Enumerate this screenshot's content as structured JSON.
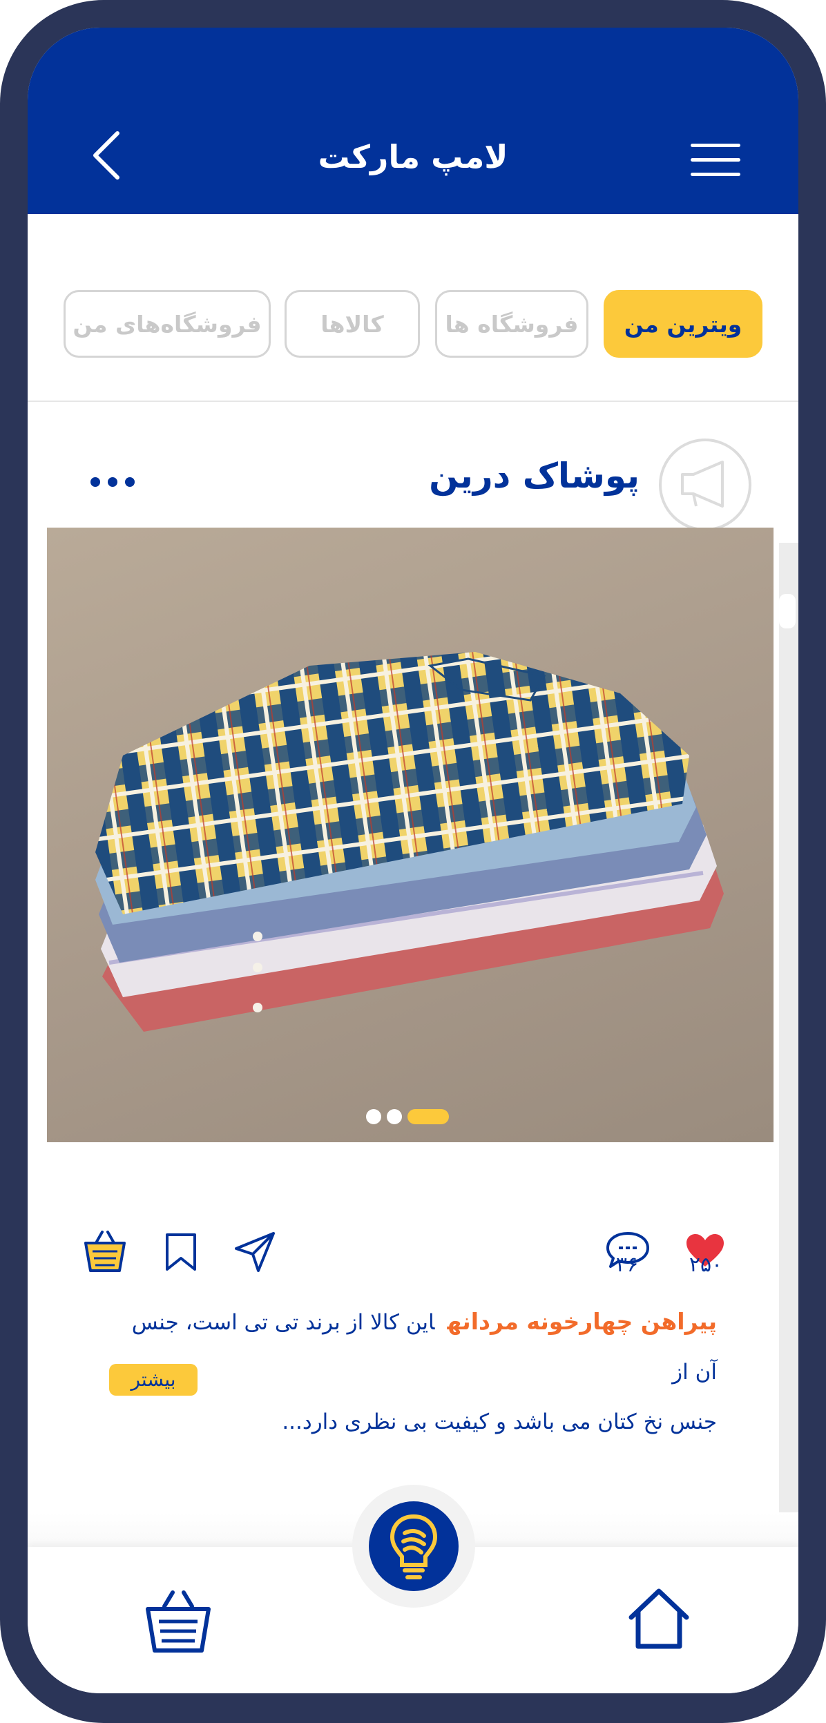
{
  "app": {
    "title": "لامپ مارکت"
  },
  "colors": {
    "primary": "#02329a",
    "accent": "#fcc93b",
    "product": "#f26b2a",
    "like": "#e8343f"
  },
  "tabs": [
    {
      "label": "ویترین من",
      "active": true
    },
    {
      "label": "فروشگاه ها",
      "active": false
    },
    {
      "label": "کالاها",
      "active": false
    },
    {
      "label": "فروشگاه‌های من",
      "active": false
    }
  ],
  "post": {
    "store_name": "پوشاک درین",
    "image_alt": "stacked shirts photo",
    "slides": {
      "count": 3,
      "active": 3
    },
    "likes": "۲۵۰",
    "comments": "۳۶",
    "product_name": "پیراهن چهارخونه مردانه",
    "description_line1": "این کالا از برند تی تی است، جنس آن از",
    "description_line2": "جنس نخ کتان می باشد و کیفیت بی نظری دارد...",
    "more_label": "بیشتر"
  },
  "icons": {
    "back": "chevron-left-icon",
    "menu": "hamburger-icon",
    "store": "megaphone-icon",
    "more": "ellipsis-icon",
    "like": "heart-icon",
    "comment": "comment-icon",
    "share": "send-icon",
    "bookmark": "bookmark-icon",
    "cart": "basket-icon",
    "home": "home-icon",
    "center": "lamp-icon"
  }
}
